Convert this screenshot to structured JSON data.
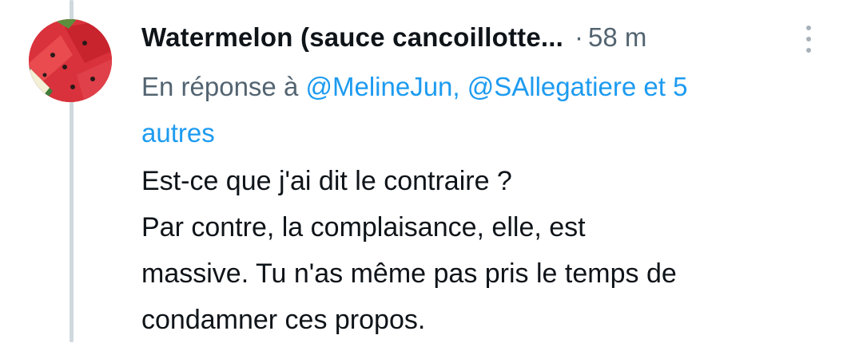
{
  "tweet": {
    "author_name": "Watermelon (sauce cancoillotte...",
    "separator": "·",
    "time": "58 m",
    "more_icon": "more-vertical-icon",
    "reply_prefix": "En réponse à",
    "mentions": [
      "@MelineJun,",
      "@SAllegatiere"
    ],
    "reply_others_line1": "et 5",
    "reply_others_line2": "autres",
    "text_lines": [
      "Est-ce que j'ai dit le contraire ?",
      "Par contre, la complaisance, elle, est",
      "massive. Tu n'as même pas pris le temps de",
      "condamner ces propos."
    ]
  },
  "colors": {
    "text_primary": "#0f1419",
    "text_secondary": "#536471",
    "link": "#1d9bf0",
    "thread_line": "#cfd9de"
  }
}
